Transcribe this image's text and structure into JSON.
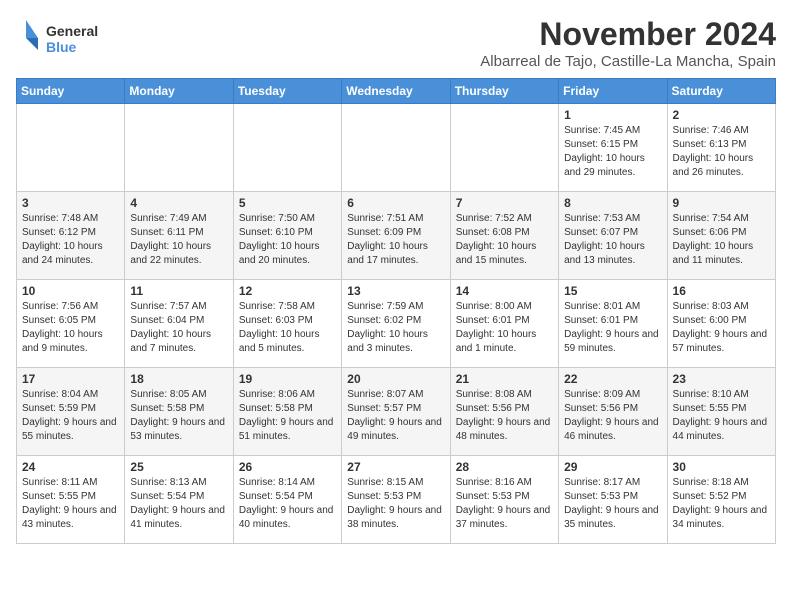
{
  "logo": {
    "line1": "General",
    "line2": "Blue"
  },
  "title": "November 2024",
  "subtitle": "Albarreal de Tajo, Castille-La Mancha, Spain",
  "weekdays": [
    "Sunday",
    "Monday",
    "Tuesday",
    "Wednesday",
    "Thursday",
    "Friday",
    "Saturday"
  ],
  "weeks": [
    [
      {
        "day": "",
        "info": ""
      },
      {
        "day": "",
        "info": ""
      },
      {
        "day": "",
        "info": ""
      },
      {
        "day": "",
        "info": ""
      },
      {
        "day": "",
        "info": ""
      },
      {
        "day": "1",
        "info": "Sunrise: 7:45 AM\nSunset: 6:15 PM\nDaylight: 10 hours and 29 minutes."
      },
      {
        "day": "2",
        "info": "Sunrise: 7:46 AM\nSunset: 6:13 PM\nDaylight: 10 hours and 26 minutes."
      }
    ],
    [
      {
        "day": "3",
        "info": "Sunrise: 7:48 AM\nSunset: 6:12 PM\nDaylight: 10 hours and 24 minutes."
      },
      {
        "day": "4",
        "info": "Sunrise: 7:49 AM\nSunset: 6:11 PM\nDaylight: 10 hours and 22 minutes."
      },
      {
        "day": "5",
        "info": "Sunrise: 7:50 AM\nSunset: 6:10 PM\nDaylight: 10 hours and 20 minutes."
      },
      {
        "day": "6",
        "info": "Sunrise: 7:51 AM\nSunset: 6:09 PM\nDaylight: 10 hours and 17 minutes."
      },
      {
        "day": "7",
        "info": "Sunrise: 7:52 AM\nSunset: 6:08 PM\nDaylight: 10 hours and 15 minutes."
      },
      {
        "day": "8",
        "info": "Sunrise: 7:53 AM\nSunset: 6:07 PM\nDaylight: 10 hours and 13 minutes."
      },
      {
        "day": "9",
        "info": "Sunrise: 7:54 AM\nSunset: 6:06 PM\nDaylight: 10 hours and 11 minutes."
      }
    ],
    [
      {
        "day": "10",
        "info": "Sunrise: 7:56 AM\nSunset: 6:05 PM\nDaylight: 10 hours and 9 minutes."
      },
      {
        "day": "11",
        "info": "Sunrise: 7:57 AM\nSunset: 6:04 PM\nDaylight: 10 hours and 7 minutes."
      },
      {
        "day": "12",
        "info": "Sunrise: 7:58 AM\nSunset: 6:03 PM\nDaylight: 10 hours and 5 minutes."
      },
      {
        "day": "13",
        "info": "Sunrise: 7:59 AM\nSunset: 6:02 PM\nDaylight: 10 hours and 3 minutes."
      },
      {
        "day": "14",
        "info": "Sunrise: 8:00 AM\nSunset: 6:01 PM\nDaylight: 10 hours and 1 minute."
      },
      {
        "day": "15",
        "info": "Sunrise: 8:01 AM\nSunset: 6:01 PM\nDaylight: 9 hours and 59 minutes."
      },
      {
        "day": "16",
        "info": "Sunrise: 8:03 AM\nSunset: 6:00 PM\nDaylight: 9 hours and 57 minutes."
      }
    ],
    [
      {
        "day": "17",
        "info": "Sunrise: 8:04 AM\nSunset: 5:59 PM\nDaylight: 9 hours and 55 minutes."
      },
      {
        "day": "18",
        "info": "Sunrise: 8:05 AM\nSunset: 5:58 PM\nDaylight: 9 hours and 53 minutes."
      },
      {
        "day": "19",
        "info": "Sunrise: 8:06 AM\nSunset: 5:58 PM\nDaylight: 9 hours and 51 minutes."
      },
      {
        "day": "20",
        "info": "Sunrise: 8:07 AM\nSunset: 5:57 PM\nDaylight: 9 hours and 49 minutes."
      },
      {
        "day": "21",
        "info": "Sunrise: 8:08 AM\nSunset: 5:56 PM\nDaylight: 9 hours and 48 minutes."
      },
      {
        "day": "22",
        "info": "Sunrise: 8:09 AM\nSunset: 5:56 PM\nDaylight: 9 hours and 46 minutes."
      },
      {
        "day": "23",
        "info": "Sunrise: 8:10 AM\nSunset: 5:55 PM\nDaylight: 9 hours and 44 minutes."
      }
    ],
    [
      {
        "day": "24",
        "info": "Sunrise: 8:11 AM\nSunset: 5:55 PM\nDaylight: 9 hours and 43 minutes."
      },
      {
        "day": "25",
        "info": "Sunrise: 8:13 AM\nSunset: 5:54 PM\nDaylight: 9 hours and 41 minutes."
      },
      {
        "day": "26",
        "info": "Sunrise: 8:14 AM\nSunset: 5:54 PM\nDaylight: 9 hours and 40 minutes."
      },
      {
        "day": "27",
        "info": "Sunrise: 8:15 AM\nSunset: 5:53 PM\nDaylight: 9 hours and 38 minutes."
      },
      {
        "day": "28",
        "info": "Sunrise: 8:16 AM\nSunset: 5:53 PM\nDaylight: 9 hours and 37 minutes."
      },
      {
        "day": "29",
        "info": "Sunrise: 8:17 AM\nSunset: 5:53 PM\nDaylight: 9 hours and 35 minutes."
      },
      {
        "day": "30",
        "info": "Sunrise: 8:18 AM\nSunset: 5:52 PM\nDaylight: 9 hours and 34 minutes."
      }
    ]
  ]
}
